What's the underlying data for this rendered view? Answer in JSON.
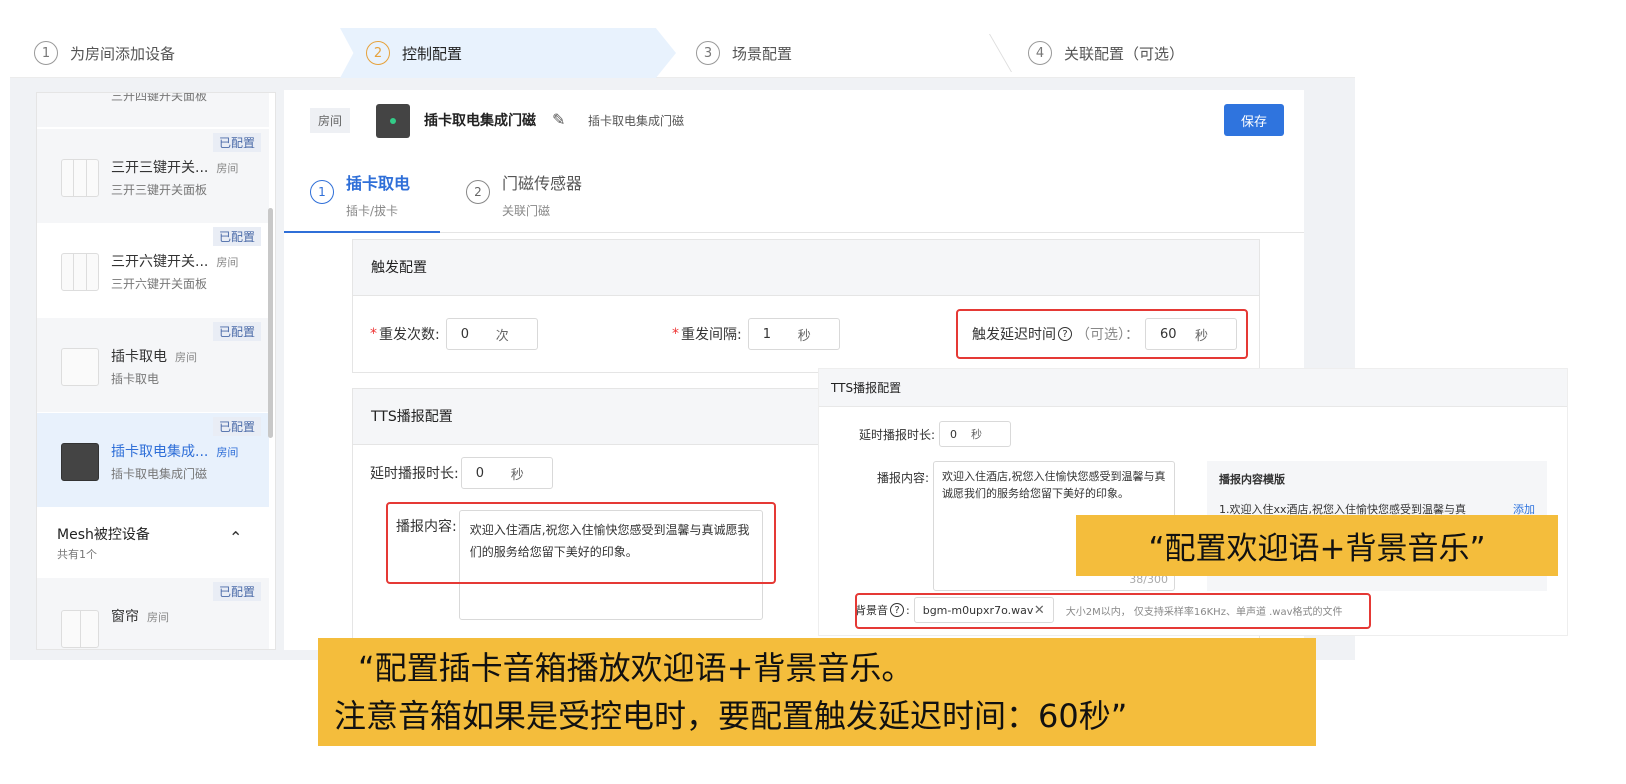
{
  "stepper": {
    "steps": [
      {
        "num": "1",
        "label": "为房间添加设备"
      },
      {
        "num": "2",
        "label": "控制配置"
      },
      {
        "num": "3",
        "label": "场景配置"
      },
      {
        "num": "4",
        "label": "关联配置（可选）"
      }
    ],
    "active_step": 2,
    "active_color": "#e6a23c"
  },
  "sidebar": {
    "top_partial_label": "三开四键开关面板",
    "devices": [
      {
        "badge": "已配置",
        "name": "三开三键开关...",
        "room": "房间",
        "sub": "三开三键开关面板",
        "icon": "switch-3-icon"
      },
      {
        "badge": "已配置",
        "name": "三开六键开关...",
        "room": "房间",
        "sub": "三开六键开关面板",
        "icon": "switch-6-icon"
      },
      {
        "badge": "已配置",
        "name": "插卡取电",
        "room": "房间",
        "sub": "插卡取电",
        "icon": "card-switch-icon"
      },
      {
        "badge": "已配置",
        "name": "插卡取电集成...",
        "room": "房间",
        "sub": "插卡取电集成门磁",
        "icon": "card-door-sensor-icon",
        "selected": true
      }
    ],
    "group": {
      "title": "Mesh被控设备",
      "count": "共有1个",
      "icon": "chevron-up-icon"
    },
    "group_devices": [
      {
        "badge": "已配置",
        "name": "窗帘",
        "room": "房间",
        "sub": "窗帘",
        "icon": "curtain-icon"
      }
    ]
  },
  "header": {
    "tag": "房间",
    "title": "插卡取电集成门磁",
    "edit_icon": "edit-icon",
    "subtitle": "插卡取电集成门磁",
    "save_label": "保存",
    "accent": "#2f74de"
  },
  "tabs": [
    {
      "num": "1",
      "label": "插卡取电",
      "sub": "插卡/拔卡",
      "active": true
    },
    {
      "num": "2",
      "label": "门磁传感器",
      "sub": "关联门磁"
    }
  ],
  "trigger": {
    "title": "触发配置",
    "repeat_count": {
      "label": "重发次数:",
      "value": "0",
      "unit": "次"
    },
    "repeat_interval": {
      "label": "重发间隔:",
      "value": "1",
      "unit": "秒"
    },
    "delay": {
      "label": "触发延迟时间",
      "optional": "（可选）：",
      "value": "60",
      "unit": "秒"
    }
  },
  "tts": {
    "title": "TTS播报配置",
    "delay": {
      "label": "延时播报时长:",
      "value": "0",
      "unit": "秒"
    },
    "content_label": "播报内容:",
    "content": "欢迎入住酒店,祝您入住愉快您感受到温馨与真诚愿我们的服务给您留下美好的印象。"
  },
  "popup": {
    "title": "TTS播报配置",
    "delay": {
      "label": "延时播报时长:",
      "value": "0",
      "unit": "秒"
    },
    "content_label": "播报内容:",
    "content": "欢迎入住酒店,祝您入住愉快您感受到温馨与真诚愿我们的服务给您留下美好的印象。",
    "count": "38/300",
    "template_title": "播报内容模版",
    "template_item": "1.欢迎入住xx酒店,祝您入住愉快您感受到温馨与真",
    "template_add": "添加",
    "bgm_label": "背景音",
    "bgm_file": "bgm-m0upxr7o.wav",
    "bgm_hint": "大小2M以内， 仅支持采样率16KHz、单声道 .wav格式的文件"
  },
  "callouts": {
    "right": "“配置欢迎语+背景音乐”",
    "bottom_line1": "“配置插卡音箱播放欢迎语+背景音乐。",
    "bottom_line2": "注意音箱如果是受控电时，要配置触发延迟时间：60秒”",
    "color": "#f4bd3c"
  },
  "highlight_color": "#e53935"
}
